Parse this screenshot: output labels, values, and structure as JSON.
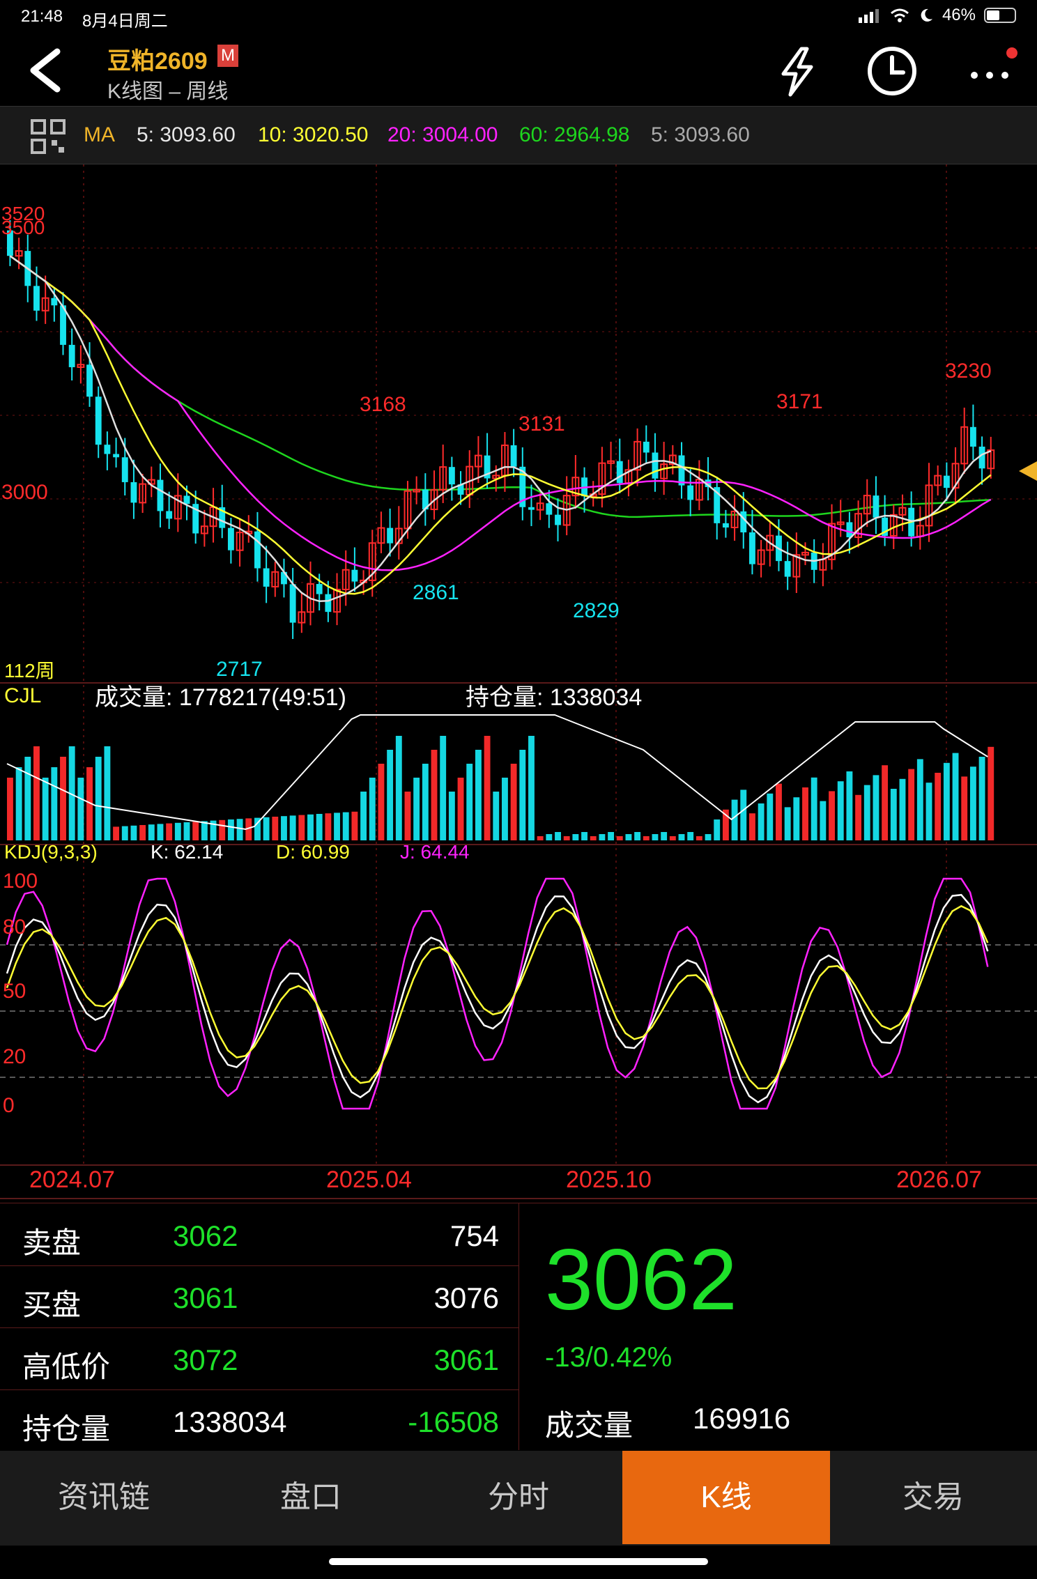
{
  "status": {
    "time": "21:48",
    "date": "8月4日周二",
    "battery": "46%"
  },
  "header": {
    "title": "豆粕2609",
    "badge": "M",
    "subtitle": "K线图 – 周线"
  },
  "ma_bar": {
    "label": "MA",
    "ma5": "5: 3093.60",
    "ma10": "10: 3020.50",
    "ma20": "20: 3004.00",
    "ma60": "60: 2964.98",
    "ma5b": "5: 3093.60"
  },
  "kline": {
    "period_label": "112周",
    "labels": {
      "p3520": "3520",
      "p3500": "3500",
      "p3000": "3000",
      "p3168": "3168",
      "p3131": "3131",
      "p3171": "3171",
      "p3230": "3230",
      "p2861": "2861",
      "p2829": "2829",
      "p2717": "2717"
    }
  },
  "volume": {
    "label": "CJL",
    "volume_text": "成交量: 1778217(49:51)",
    "oi_text": "持仓量: 1338034"
  },
  "kdj": {
    "label": "KDJ(9,3,3)",
    "k": "K: 62.14",
    "d": "D: 60.99",
    "j": "J: 64.44",
    "y100": "100",
    "y80": "80",
    "y50": "50",
    "y20": "20",
    "y0": "0"
  },
  "dates": [
    "2024.07",
    "2025.04",
    "2025.10",
    "2026.07"
  ],
  "quote": {
    "sell": {
      "label": "卖盘",
      "price": "3062",
      "qty": "754"
    },
    "buy": {
      "label": "买盘",
      "price": "3061",
      "qty": "3076"
    },
    "hilo": {
      "label": "高低价",
      "high": "3072",
      "low": "3061"
    },
    "oi": {
      "label": "持仓量",
      "value": "1338034",
      "change": "-16508"
    },
    "last": "3062",
    "change": "-13/0.42%",
    "volume_label": "成交量",
    "volume": "169916"
  },
  "tabs": [
    "资讯链",
    "盘口",
    "分时",
    "K线",
    "交易"
  ],
  "colors": {
    "up": "#ff2b2b",
    "down": "#16e3ee",
    "ma5": "#e0e0e0",
    "ma10": "#ffff33",
    "ma20": "#ff22ff",
    "ma60": "#1ed61e",
    "accent": "#e8680f"
  }
}
